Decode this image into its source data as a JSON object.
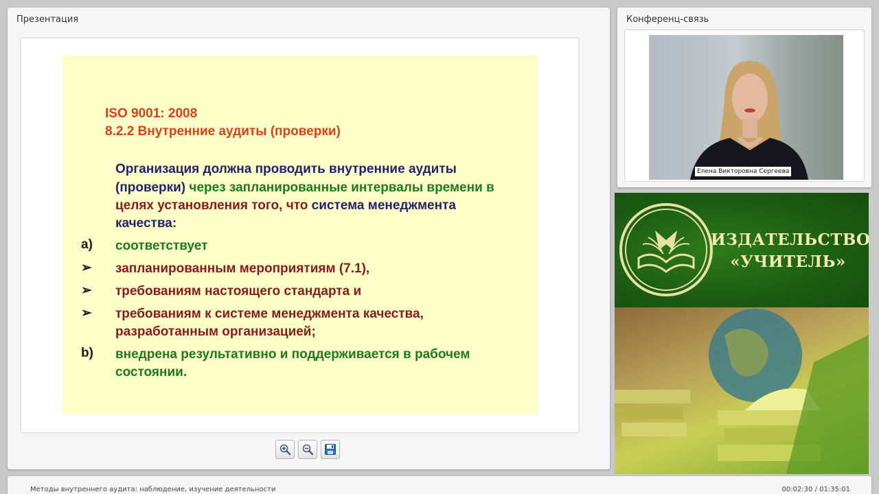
{
  "presentation": {
    "panel_title": "Презентация",
    "slide": {
      "standard": "ISO 9001: 2008",
      "clause": "8.2.2  Внутренние аудиты (проверки)",
      "intro_line1": "Организация должна проводить внутренние аудиты",
      "intro_line2a": "(проверки) ",
      "intro_line2b": "через запланированные интервалы времени в",
      "intro_line3a": "целях установления того, что ",
      "intro_line3b": "система менеджмента",
      "intro_line4": "качества:",
      "item_a_marker": "a)",
      "item_a_text": "соответствует",
      "bullet_marker": "➢",
      "bullet1": "запланированным мероприятиям (7.1),",
      "bullet2": "требованиям настоящего стандарта и",
      "bullet3_line1": "требованиям к системе менеджмента качества,",
      "bullet3_line2": "разработанным организацией;",
      "item_b_marker": "b)",
      "item_b_line1": "внедрена результативно и поддерживается в рабочем",
      "item_b_line2": "состоянии."
    },
    "toolbar": {
      "zoom_in_icon": "zoom-in-icon",
      "zoom_out_icon": "zoom-out-icon",
      "save_icon": "floppy-disk-icon"
    }
  },
  "conference": {
    "panel_title": "Конференц-связь",
    "speaker_name": "Елена Викторовна Сергеева"
  },
  "banner": {
    "line1": "ИЗДАТЕЛЬСТВО",
    "line2": "«УЧИТЕЛЬ»"
  },
  "footer": {
    "lesson_title": "Методы внутреннего аудита: наблюдение, изучение деятельности",
    "timecode": "00:02:30 / 01:35:01"
  },
  "colors": {
    "slide_bg": "#fefec8",
    "heading_orange": "#d9411b",
    "text_navy": "#22226e",
    "text_green": "#1f7a1f",
    "text_maroon": "#8b1a1a",
    "banner_green": "#1c5c12"
  }
}
